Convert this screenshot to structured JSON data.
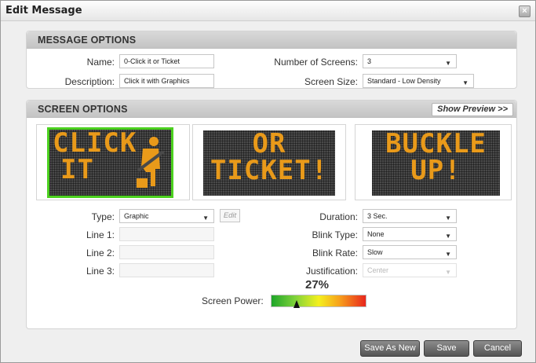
{
  "dialog": {
    "title": "Edit Message",
    "close_glyph": "×"
  },
  "message_options": {
    "header": "MESSAGE OPTIONS",
    "name_label": "Name:",
    "name_value": "0-Click it or Ticket",
    "description_label": "Description:",
    "description_value": "Click it with Graphics",
    "num_screens_label": "Number of Screens:",
    "num_screens_value": "3",
    "screen_size_label": "Screen Size:",
    "screen_size_value": "Standard - Low Density"
  },
  "screen_options": {
    "header": "SCREEN OPTIONS",
    "show_preview_label": "Show Preview >>",
    "screens": [
      {
        "line1": "CLICK",
        "line2": "IT",
        "icon": "seatbelt-icon",
        "selected": true
      },
      {
        "line1": "OR",
        "line2": "TICKET!",
        "selected": false
      },
      {
        "line1": "BUCKLE",
        "line2": "UP!",
        "selected": false
      }
    ],
    "type_label": "Type:",
    "type_value": "Graphic",
    "edit_label": "Edit",
    "line1_label": "Line 1:",
    "line2_label": "Line 2:",
    "line3_label": "Line 3:",
    "duration_label": "Duration:",
    "duration_value": "3 Sec.",
    "blink_type_label": "Blink Type:",
    "blink_type_value": "None",
    "blink_rate_label": "Blink Rate:",
    "blink_rate_value": "Slow",
    "justification_label": "Justification:",
    "justification_value": "Center",
    "screen_power_label": "Screen Power:",
    "screen_power_value": "27%",
    "screen_power_fraction": 0.27
  },
  "footer": {
    "save_as_new_label": "Save As New",
    "save_label": "Save",
    "cancel_label": "Cancel"
  },
  "colors": {
    "led_amber": "#e99a1a",
    "selected_border": "#4cd11f",
    "button_dark": "#545454"
  }
}
